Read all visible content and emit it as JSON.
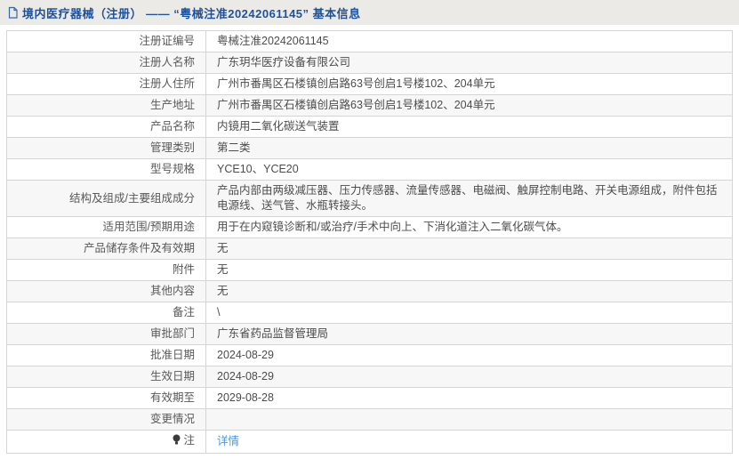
{
  "header": {
    "icon": "document-icon",
    "title": "境内医疗器械（注册） —— “粤械注准20242061145” 基本信息"
  },
  "table": {
    "rows": [
      {
        "label": "注册证编号",
        "value": "粤械注准20242061145"
      },
      {
        "label": "注册人名称",
        "value": "广东玥华医疗设备有限公司"
      },
      {
        "label": "注册人住所",
        "value": "广州市番禺区石楼镇创启路63号创启1号楼102、204单元"
      },
      {
        "label": "生产地址",
        "value": "广州市番禺区石楼镇创启路63号创启1号楼102、204单元"
      },
      {
        "label": "产品名称",
        "value": "内镜用二氧化碳送气装置"
      },
      {
        "label": "管理类别",
        "value": "第二类"
      },
      {
        "label": "型号规格",
        "value": "YCE10、YCE20"
      },
      {
        "label": "结构及组成/主要组成成分",
        "value": "产品内部由两级减压器、压力传感器、流量传感器、电磁阀、触屏控制电路、开关电源组成，附件包括电源线、送气管、水瓶转接头。"
      },
      {
        "label": "适用范围/预期用途",
        "value": "用于在内窥镜诊断和/或治疗/手术中向上、下消化道注入二氧化碳气体。"
      },
      {
        "label": "产品储存条件及有效期",
        "value": "无"
      },
      {
        "label": "附件",
        "value": "无"
      },
      {
        "label": "其他内容",
        "value": "无"
      },
      {
        "label": "备注",
        "value": "\\"
      },
      {
        "label": "审批部门",
        "value": "广东省药品监督管理局"
      },
      {
        "label": "批准日期",
        "value": "2024-08-29"
      },
      {
        "label": "生效日期",
        "value": "2024-08-29"
      },
      {
        "label": "有效期至",
        "value": "2029-08-28"
      },
      {
        "label": "变更情况",
        "value": ""
      },
      {
        "label": "注",
        "value": "详情",
        "link": true,
        "icon": "bulb-icon"
      }
    ]
  },
  "colors": {
    "header_bg": "#ebeae6",
    "header_text": "#1c519e",
    "border": "#d5d5d5",
    "row_alt_bg": "#f7f7f7",
    "link": "#4698dc",
    "label_text": "#595959",
    "value_text": "#4c4c4c"
  }
}
